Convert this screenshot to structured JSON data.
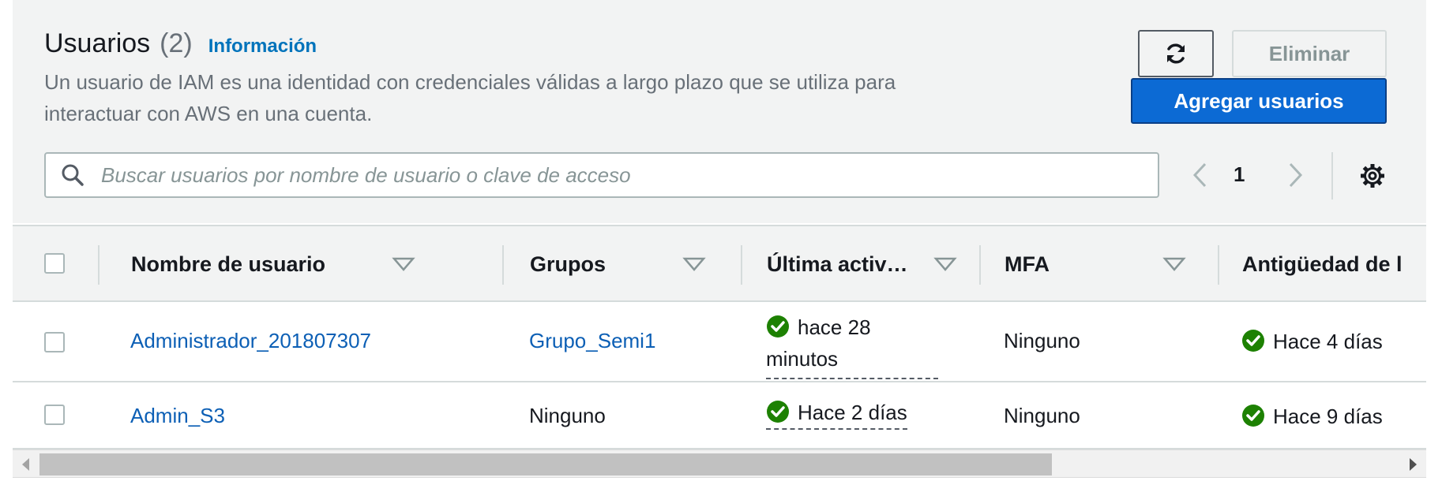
{
  "header": {
    "title": "Usuarios",
    "count": "(2)",
    "info_link": "Información",
    "description": "Un usuario de IAM es una identidad con credenciales válidas a largo plazo que se utiliza para interactuar con AWS en una cuenta."
  },
  "actions": {
    "refresh_icon": "refresh-icon",
    "delete_label": "Eliminar",
    "add_label": "Agregar usuarios"
  },
  "search": {
    "placeholder": "Buscar usuarios por nombre de usuario o clave de acceso",
    "value": ""
  },
  "pagination": {
    "current_page": "1"
  },
  "table": {
    "columns": [
      "Nombre de usuario",
      "Grupos",
      "Última activ…",
      "MFA",
      "Antigüedad de l"
    ],
    "rows": [
      {
        "username": "Administrador_201807307",
        "groups": "Grupo_Semi1",
        "last_activity": "hace 28 minutos",
        "mfa": "Ninguno",
        "age": "Hace 4 días"
      },
      {
        "username": "Admin_S3",
        "groups": "Ninguno",
        "last_activity": "Hace 2 días",
        "mfa": "Ninguno",
        "age": "Hace 9 días"
      }
    ]
  },
  "colors": {
    "primary": "#0c6ad4",
    "link": "#0c5fb5",
    "info_link": "#0073bb",
    "success": "#1d8102",
    "panel_bg": "#f2f3f3"
  }
}
